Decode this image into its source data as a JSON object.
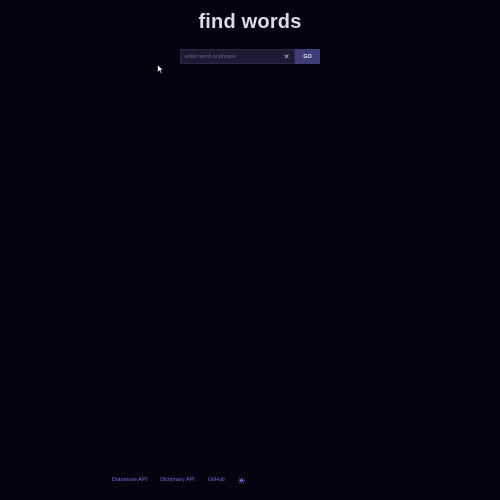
{
  "header": {
    "title": "find words"
  },
  "search": {
    "placeholder": "enter word or phrase",
    "value": "",
    "clear_label": "✕",
    "go_label": "GO"
  },
  "footer": {
    "links": [
      {
        "label": "Datamuse API"
      },
      {
        "label": "Dictionary API"
      },
      {
        "label": "GitHub"
      }
    ],
    "theme_toggle_icon": "sun-icon"
  },
  "colors": {
    "background": "#04030f",
    "accent": "#3f3d77",
    "link": "#6c6cd8",
    "title": "#dcdbe8"
  }
}
